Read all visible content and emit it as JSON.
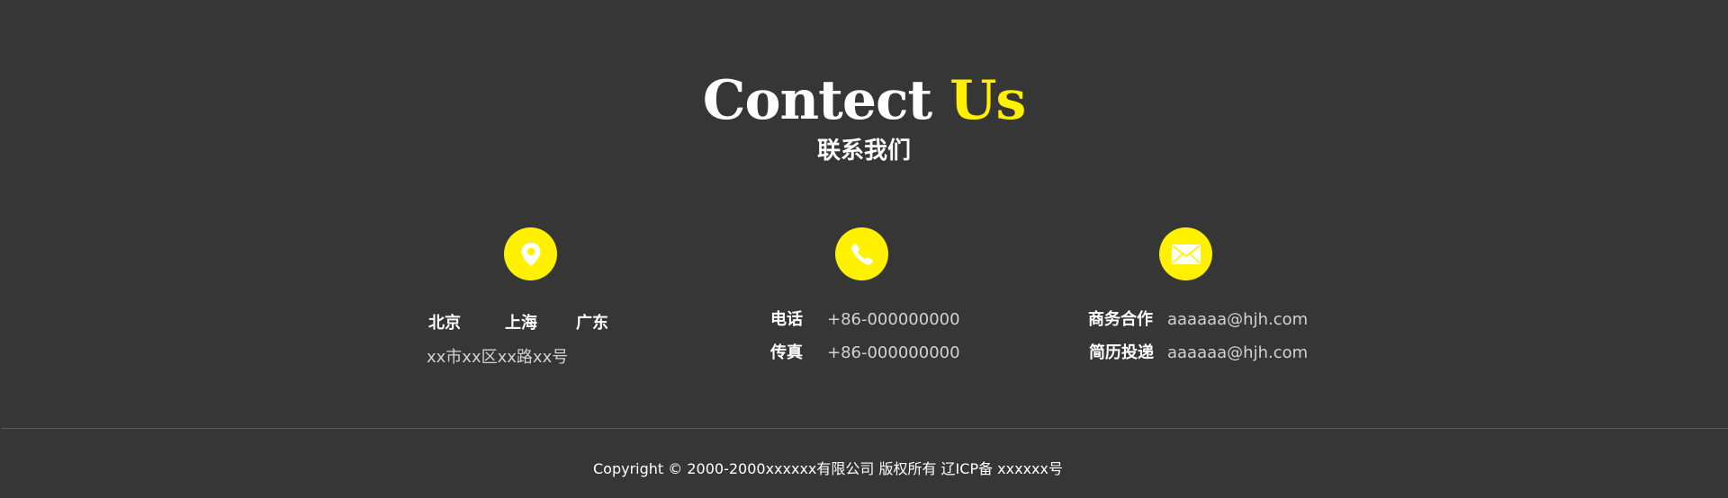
{
  "header": {
    "title_main": "Contect",
    "title_accent": "Us",
    "subtitle": "联系我们"
  },
  "address": {
    "icon": "location-pin-icon",
    "cities": [
      "北京",
      "上海",
      "广东"
    ],
    "detail": "xx市xx区xx路xx号"
  },
  "phone": {
    "icon": "phone-icon",
    "rows": [
      {
        "label": "电话",
        "value": "+86-000000000"
      },
      {
        "label": "传真",
        "value": "+86-000000000"
      }
    ]
  },
  "email": {
    "icon": "envelope-icon",
    "rows": [
      {
        "label": "商务合作",
        "value": "aaaaaa@hjh.com"
      },
      {
        "label": "简历投递",
        "value": "aaaaaa@hjh.com"
      }
    ]
  },
  "footer": {
    "copyright": "Copyright © 2000-2000xxxxxx有限公司 版权所有 辽ICP备 xxxxxx号"
  },
  "colors": {
    "background": "#363636",
    "accent": "#fff100",
    "text": "#ffffff",
    "muted_text": "#d2d2d2"
  }
}
